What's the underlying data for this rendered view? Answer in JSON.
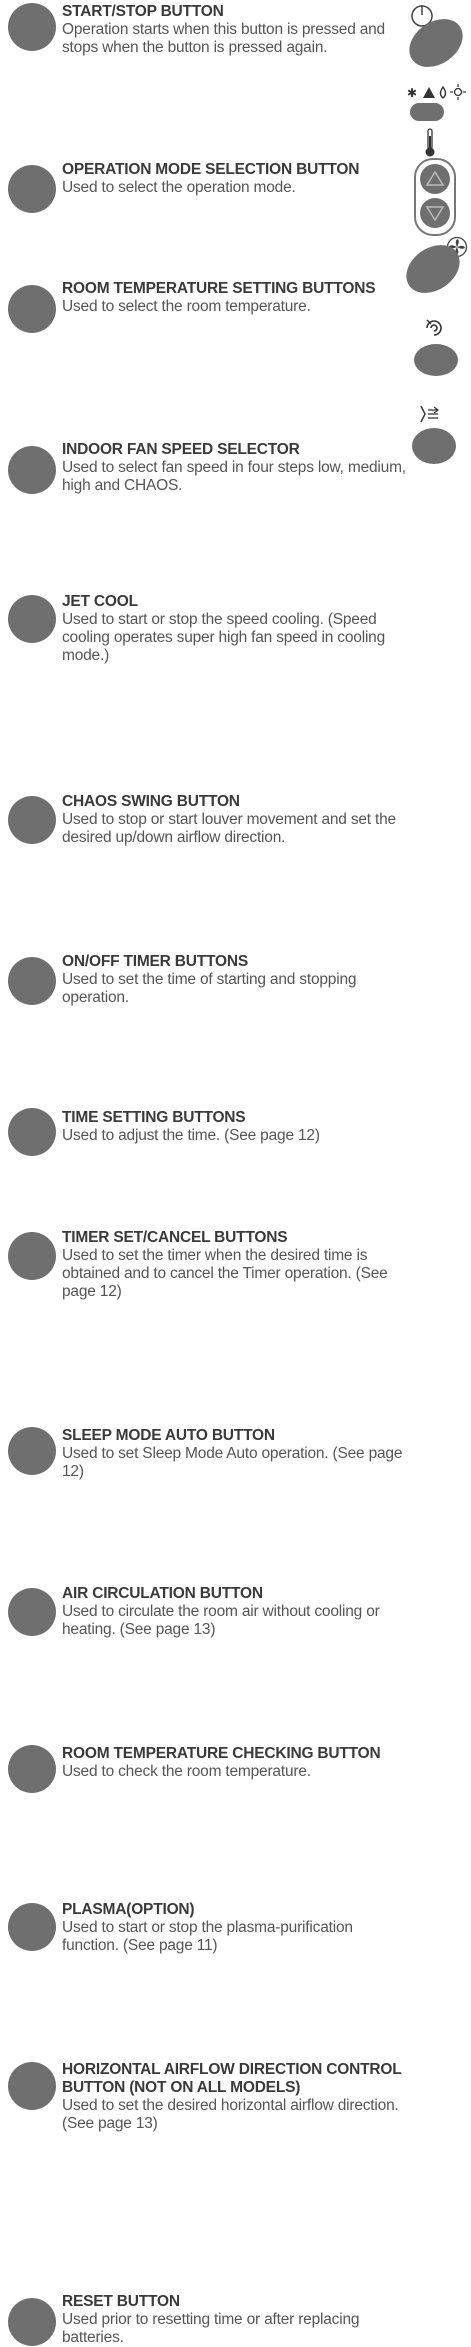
{
  "items": [
    {
      "title": "START/STOP BUTTON",
      "desc": "Operation starts when this button is pressed and stops when the button is pressed again."
    },
    {
      "title": "OPERATION MODE SELECTION BUTTON",
      "desc": "Used to select the operation mode."
    },
    {
      "title": "ROOM TEMPERATURE SETTING BUTTONS",
      "desc": "Used to select the room temperature."
    },
    {
      "title": "INDOOR FAN SPEED SELECTOR",
      "desc": "Used to select fan speed in four steps low, medium, high and CHAOS."
    },
    {
      "title": "JET COOL",
      "desc": "Used to start or stop the speed cooling. (Speed cooling operates super high fan speed in cooling mode.)"
    },
    {
      "title": "CHAOS SWING BUTTON",
      "desc": "Used to stop or start louver movement and set the desired up/down airflow direction."
    },
    {
      "title": "ON/OFF TIMER BUTTONS",
      "desc": "Used to set the time of starting and stopping operation."
    },
    {
      "title": "TIME SETTING BUTTONS",
      "desc": "Used to adjust the time. (See page 12)"
    },
    {
      "title": "TIMER SET/CANCEL BUTTONS",
      "desc": "Used to set the timer when the desired time is obtained and to cancel the Timer operation. (See page 12)"
    },
    {
      "title": "SLEEP MODE AUTO BUTTON",
      "desc": "Used to set Sleep Mode Auto operation. (See page 12)"
    },
    {
      "title": "AIR CIRCULATION BUTTON",
      "desc": "Used to circulate the room air without cooling or heating. (See page 13)"
    },
    {
      "title": "ROOM TEMPERATURE CHECKING BUTTON",
      "desc": "Used to check the room temperature."
    },
    {
      "title": "PLASMA(OPTION)",
      "desc": "Used to start or stop the plasma-purification function. (See page 11)"
    },
    {
      "title": "HORIZONTAL AIRFLOW DIRECTION CONTROL BUTTON (NOT ON ALL MODELS)",
      "desc": "Used to set the desired horizontal airflow direction. (See page 13)"
    },
    {
      "title": "RESET BUTTON",
      "desc": "Used prior to resetting time or after replacing batteries."
    }
  ],
  "icons": {
    "power": "power-icon",
    "modes": "mode-icons",
    "thermometer": "thermometer-icon",
    "fan": "fan-icon",
    "jet": "jet-cool-icon",
    "swing": "swing-icon"
  }
}
